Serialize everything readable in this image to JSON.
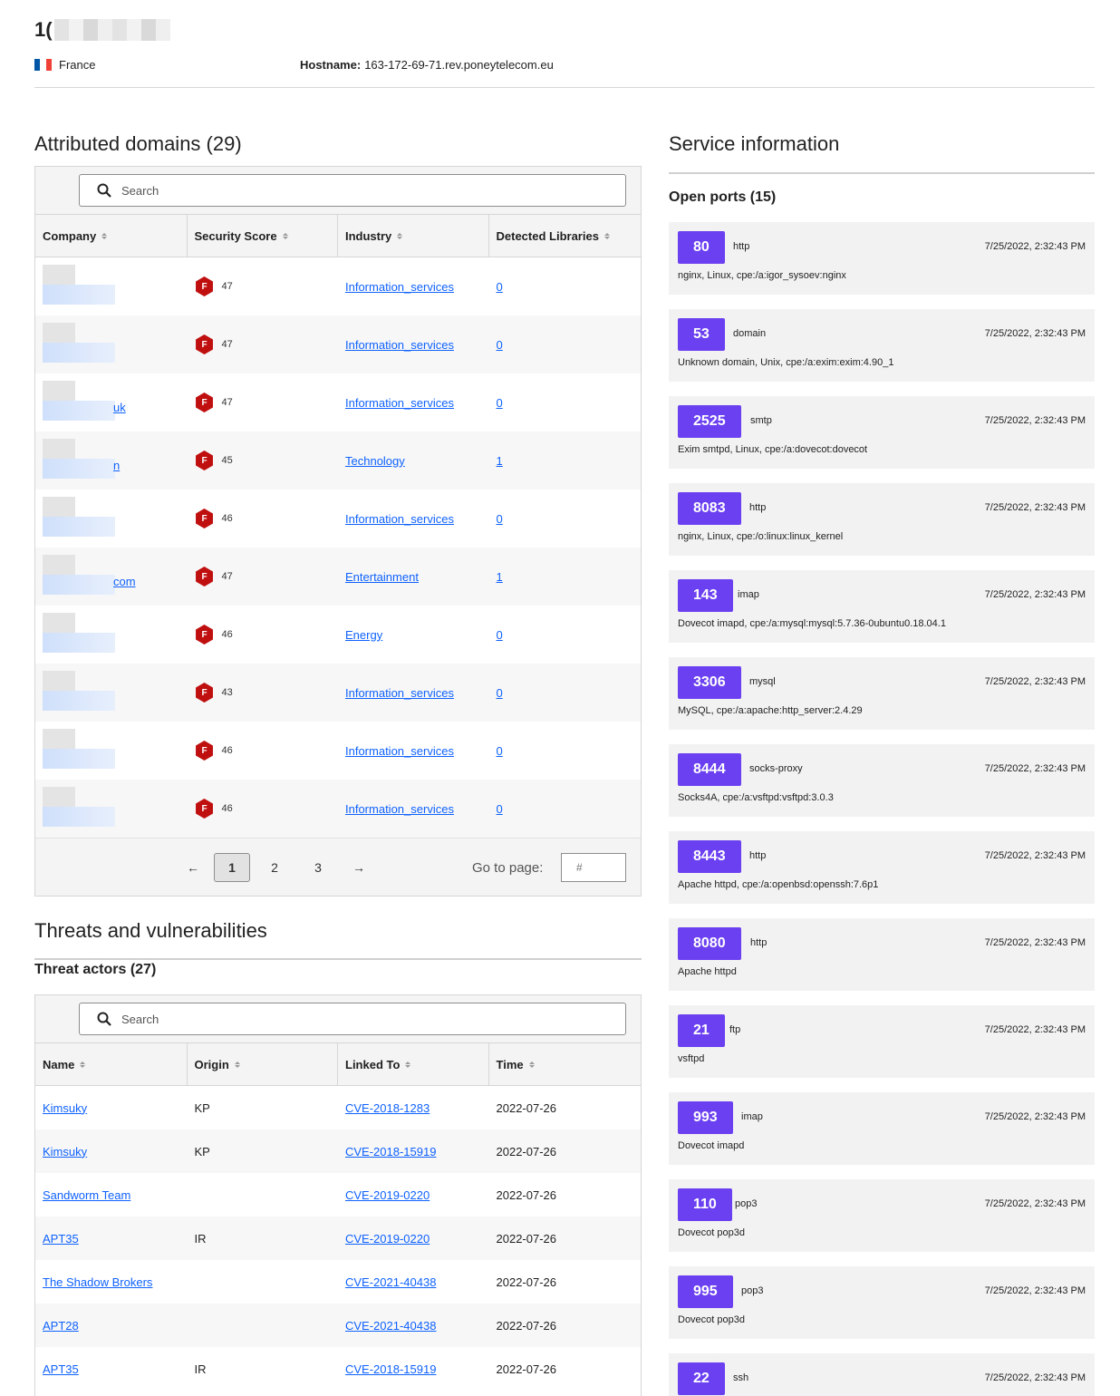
{
  "header": {
    "ip_prefix": "1(",
    "country": "France",
    "hostname_label": "Hostname:",
    "hostname_value": "163-172-69-71.rev.poneytelecom.eu"
  },
  "domains": {
    "title": "Attributed domains (29)",
    "search_placeholder": "Search",
    "columns": [
      "Company",
      "Security Score",
      "Industry",
      "Detected Libraries"
    ],
    "rows": [
      {
        "tail": "",
        "grade": "F",
        "score": "47",
        "industry": "Information_services",
        "libs": "0"
      },
      {
        "tail": "",
        "grade": "F",
        "score": "47",
        "industry": "Information_services",
        "libs": "0"
      },
      {
        "tail": "uk",
        "grade": "F",
        "score": "47",
        "industry": "Information_services",
        "libs": "0"
      },
      {
        "tail": "n",
        "grade": "F",
        "score": "45",
        "industry": "Technology",
        "libs": "1"
      },
      {
        "tail": "",
        "grade": "F",
        "score": "46",
        "industry": "Information_services",
        "libs": "0"
      },
      {
        "tail": "com",
        "grade": "F",
        "score": "47",
        "industry": "Entertainment",
        "libs": "1"
      },
      {
        "tail": "",
        "grade": "F",
        "score": "46",
        "industry": "Energy",
        "libs": "0"
      },
      {
        "tail": "",
        "grade": "F",
        "score": "43",
        "industry": "Information_services",
        "libs": "0"
      },
      {
        "tail": "",
        "grade": "F",
        "score": "46",
        "industry": "Information_services",
        "libs": "0"
      },
      {
        "tail": "",
        "grade": "F",
        "score": "46",
        "industry": "Information_services",
        "libs": "0"
      }
    ],
    "pagination": {
      "prev": "←",
      "pages": [
        "1",
        "2",
        "3"
      ],
      "current": "1",
      "next": "→",
      "goto_label": "Go to page:",
      "goto_placeholder": "#"
    }
  },
  "threats": {
    "title": "Threats and vulnerabilities",
    "subtitle": "Threat actors (27)",
    "search_placeholder": "Search",
    "columns": [
      "Name",
      "Origin",
      "Linked To",
      "Time"
    ],
    "rows": [
      {
        "name": "Kimsuky",
        "origin": "KP",
        "cve": "CVE-2018-1283",
        "time": "2022-07-26"
      },
      {
        "name": "Kimsuky",
        "origin": "KP",
        "cve": "CVE-2018-15919",
        "time": "2022-07-26"
      },
      {
        "name": "Sandworm Team",
        "origin": "",
        "cve": "CVE-2019-0220",
        "time": "2022-07-26"
      },
      {
        "name": "APT35",
        "origin": "IR",
        "cve": "CVE-2019-0220",
        "time": "2022-07-26"
      },
      {
        "name": "The Shadow Brokers",
        "origin": "",
        "cve": "CVE-2021-40438",
        "time": "2022-07-26"
      },
      {
        "name": "APT28",
        "origin": "",
        "cve": "CVE-2021-40438",
        "time": "2022-07-26"
      },
      {
        "name": "APT35",
        "origin": "IR",
        "cve": "CVE-2018-15919",
        "time": "2022-07-26"
      }
    ]
  },
  "service": {
    "title": "Service information",
    "ports_title": "Open ports (15)",
    "ports": [
      {
        "port": "80",
        "proto": "http",
        "time": "7/25/2022, 2:32:43 PM",
        "desc": "nginx, Linux, cpe:/a:igor_sysoev:nginx"
      },
      {
        "port": "53",
        "proto": "domain",
        "time": "7/25/2022, 2:32:43 PM",
        "desc": "Unknown domain, Unix, cpe:/a:exim:exim:4.90_1"
      },
      {
        "port": "2525",
        "proto": "smtp",
        "time": "7/25/2022, 2:32:43 PM",
        "desc": "Exim smtpd, Linux, cpe:/a:dovecot:dovecot"
      },
      {
        "port": "8083",
        "proto": "http",
        "time": "7/25/2022, 2:32:43 PM",
        "desc": "nginx, Linux, cpe:/o:linux:linux_kernel"
      },
      {
        "port": "143",
        "proto": "imap",
        "time": "7/25/2022, 2:32:43 PM",
        "desc": "Dovecot imapd, cpe:/a:mysql:mysql:5.7.36-0ubuntu0.18.04.1"
      },
      {
        "port": "3306",
        "proto": "mysql",
        "time": "7/25/2022, 2:32:43 PM",
        "desc": "MySQL, cpe:/a:apache:http_server:2.4.29"
      },
      {
        "port": "8444",
        "proto": "socks-proxy",
        "time": "7/25/2022, 2:32:43 PM",
        "desc": "Socks4A, cpe:/a:vsftpd:vsftpd:3.0.3"
      },
      {
        "port": "8443",
        "proto": "http",
        "time": "7/25/2022, 2:32:43 PM",
        "desc": "Apache httpd, cpe:/a:openbsd:openssh:7.6p1"
      },
      {
        "port": "8080",
        "proto": "http",
        "time": "7/25/2022, 2:32:43 PM",
        "desc": "Apache httpd"
      },
      {
        "port": "21",
        "proto": "ftp",
        "time": "7/25/2022, 2:32:43 PM",
        "desc": "vsftpd"
      },
      {
        "port": "993",
        "proto": "imap",
        "time": "7/25/2022, 2:32:43 PM",
        "desc": "Dovecot imapd"
      },
      {
        "port": "110",
        "proto": "pop3",
        "time": "7/25/2022, 2:32:43 PM",
        "desc": "Dovecot pop3d"
      },
      {
        "port": "995",
        "proto": "pop3",
        "time": "7/25/2022, 2:32:43 PM",
        "desc": "Dovecot pop3d"
      },
      {
        "port": "22",
        "proto": "ssh",
        "time": "7/25/2022, 2:32:43 PM",
        "desc": ""
      }
    ]
  },
  "colors": {
    "port_badge": "#6b40f0",
    "grade_f": "#c00f0f",
    "link": "#0f62fe",
    "flag": [
      "#0055a4",
      "#ffffff",
      "#ef4135"
    ]
  }
}
